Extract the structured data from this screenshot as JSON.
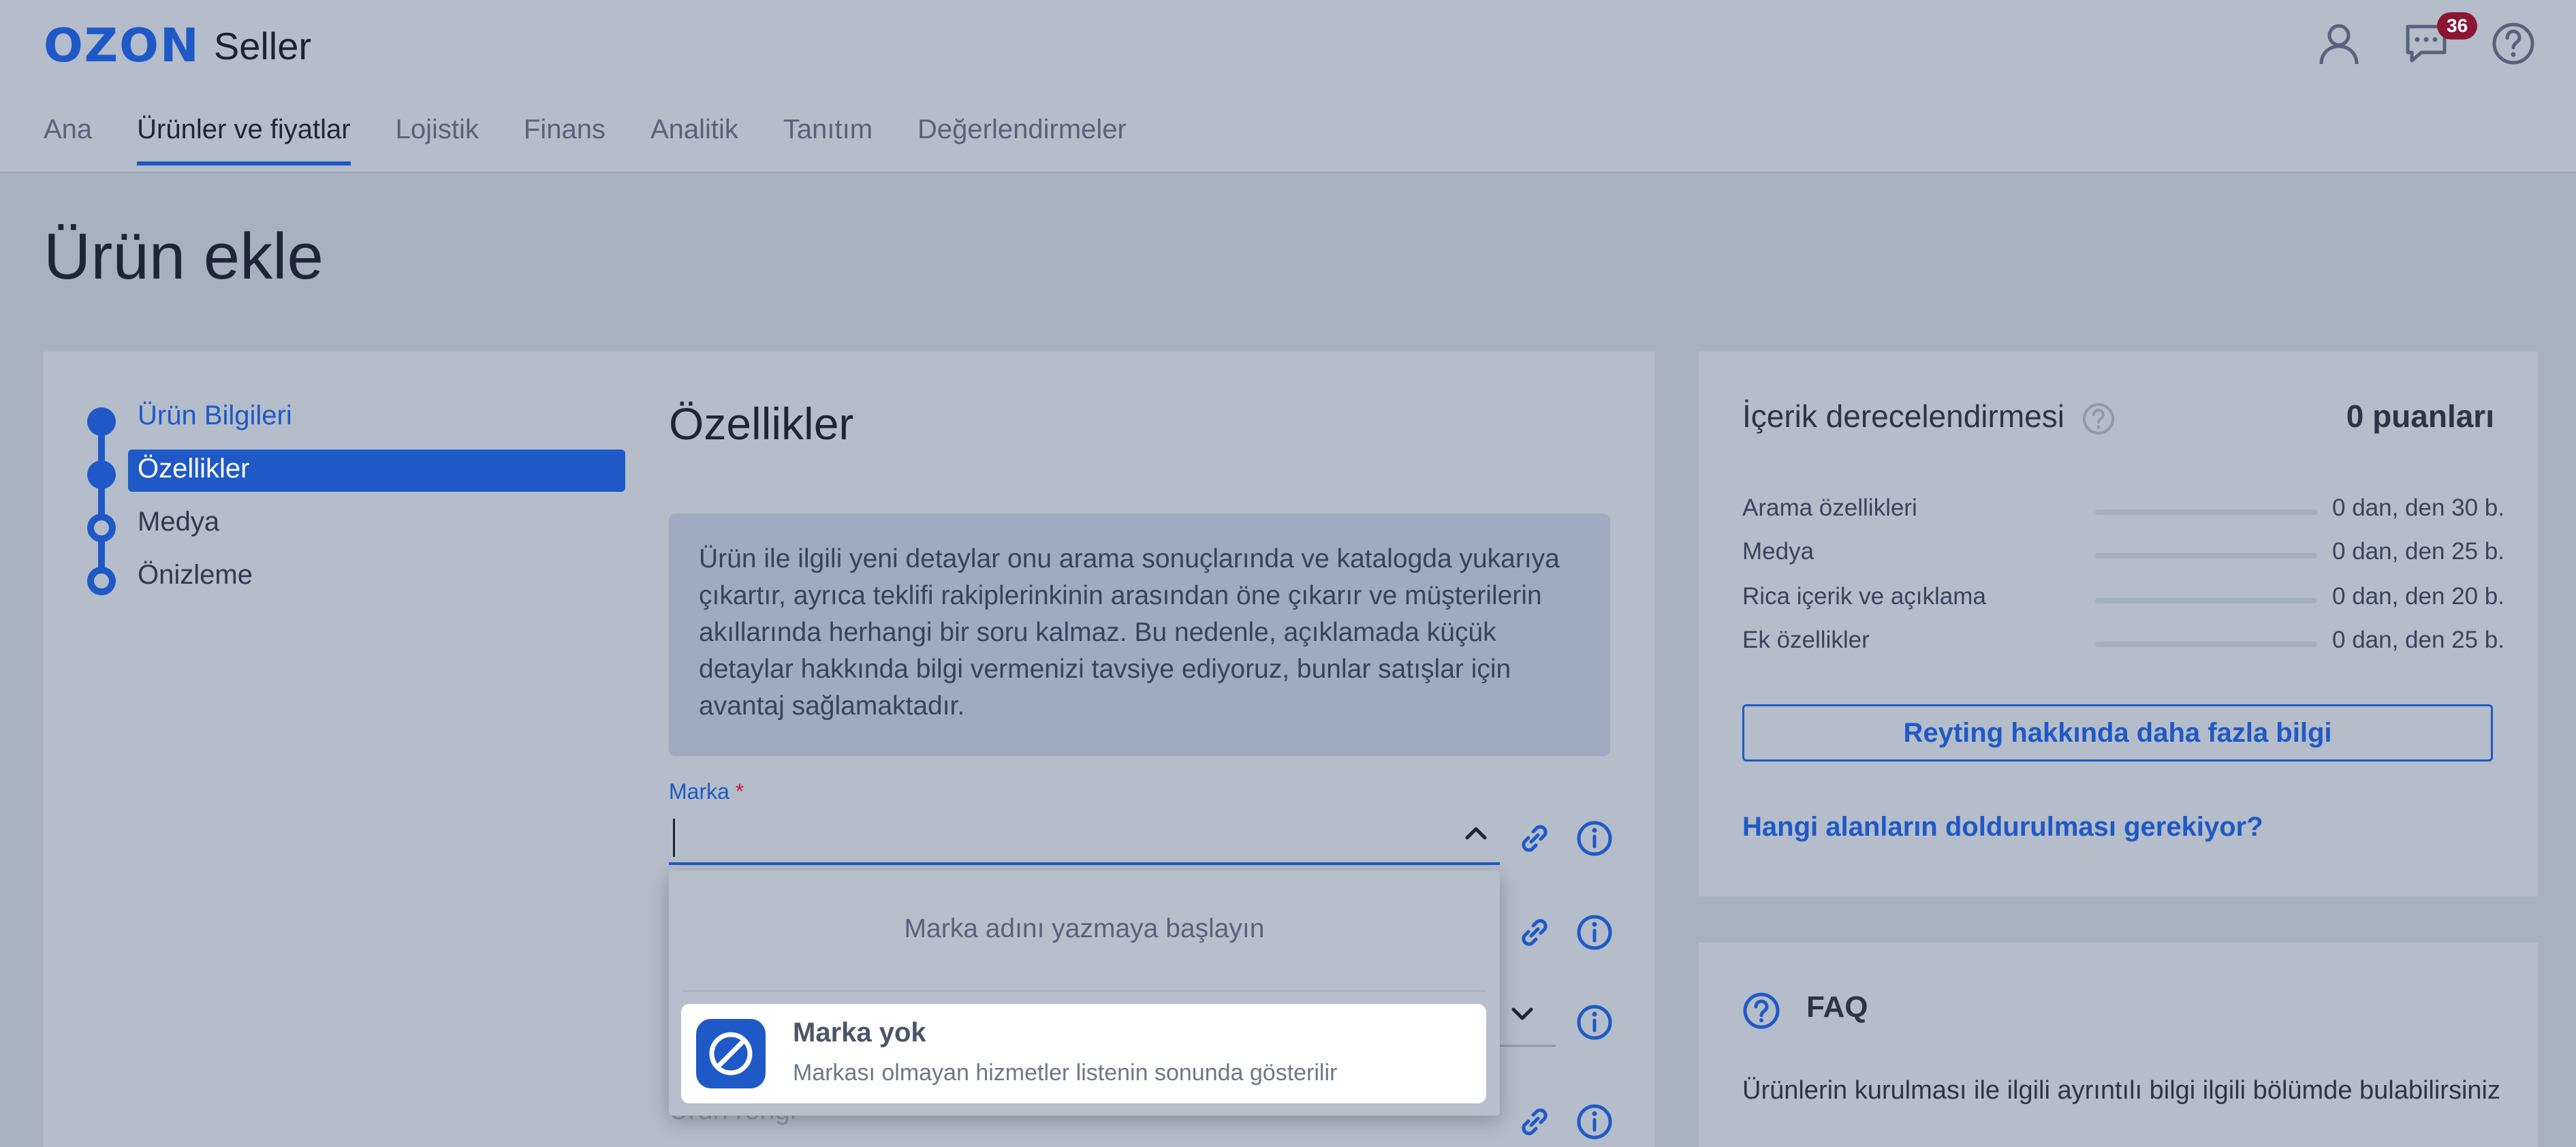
{
  "header": {
    "logo_brand": "OZON",
    "logo_product": "Seller",
    "notifications_count": "36",
    "nav": [
      {
        "label": "Ana"
      },
      {
        "label": "Ürünler ve fiyatlar",
        "active": true
      },
      {
        "label": "Lojistik"
      },
      {
        "label": "Finans"
      },
      {
        "label": "Analitik"
      },
      {
        "label": "Tanıtım"
      },
      {
        "label": "Değerlendirmeler"
      }
    ]
  },
  "page": {
    "title": "Ürün ekle"
  },
  "steps": [
    {
      "label": "Ürün Bilgileri",
      "state": "done"
    },
    {
      "label": "Özellikler",
      "state": "current"
    },
    {
      "label": "Medya",
      "state": "todo"
    },
    {
      "label": "Önizleme",
      "state": "todo"
    }
  ],
  "form": {
    "section_title": "Özellikler",
    "info_text": "Ürün ile ilgili yeni detaylar onu arama sonuçlarında ve katalogda yukarıya çıkartır, ayrıca teklifi rakiplerinkinin arasından öne çıkarır ve müşterilerin akıllarında herhangi bir soru kalmaz. Bu nedenle, açıklamada küçük detaylar hakkında bilgi vermenizi tavsiye ediyoruz, bunlar satışlar için avantaj sağlamaktadır.",
    "brand_label": "Marka",
    "required_mark": "*",
    "brand_value": "",
    "partial_field_label": "Ürün rengi",
    "dropdown": {
      "hint": "Marka adını yazmaya başlayın",
      "option_title": "Marka yok",
      "option_subtitle": "Markası olmayan hizmetler listenin sonunda gösterilir"
    }
  },
  "rating": {
    "title": "İçerik derecelendirmesi",
    "points": "0 puanları",
    "rows": [
      {
        "label": "Arama özellikleri",
        "value": "0 dan, den 30 b.",
        "progress": 0
      },
      {
        "label": "Medya",
        "value": "0 dan, den 25 b.",
        "progress": 0
      },
      {
        "label": "Rica içerik ve açıklama",
        "value": "0 dan, den 20 b.",
        "progress": 0
      },
      {
        "label": "Ek özellikler",
        "value": "0 dan, den 25 b.",
        "progress": 0
      }
    ],
    "more_button": "Reyting hakkında daha fazla bilgi",
    "fields_link": "Hangi alanların doldurulması gerekiyor?"
  },
  "faq": {
    "title": "FAQ",
    "text": "Ürünlerin kurulması ile ilgili ayrıntılı bilgi ilgili bölümde bulabilirsiniz"
  },
  "colors": {
    "accent": "#1f59c7",
    "badge": "#8b1533",
    "required": "#c41a3c"
  }
}
